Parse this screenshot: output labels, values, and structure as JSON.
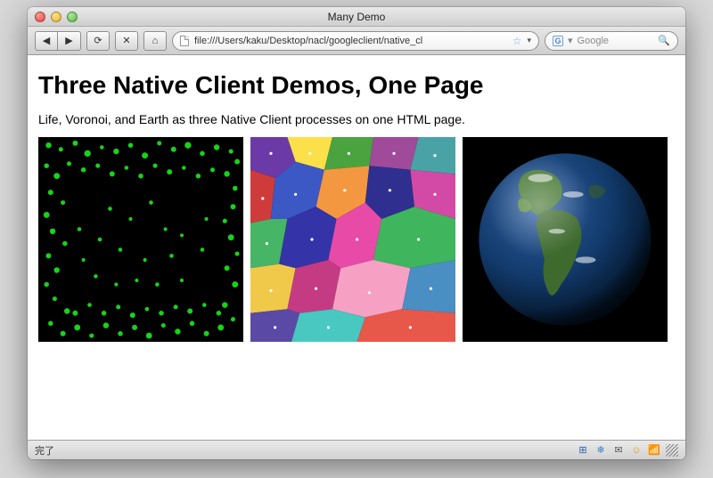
{
  "window": {
    "title": "Many Demo"
  },
  "toolbar": {
    "back": "◀",
    "fwd": "▶",
    "reload": "⟳",
    "stop": "✕",
    "home": "⌂"
  },
  "address": {
    "url": "file:///Users/kaku/Desktop/nacl/googleclient/native_cl",
    "star": "☆",
    "dropdown": "▾"
  },
  "search": {
    "engine_glyph": "G",
    "dropdown": "▾",
    "placeholder": "Google",
    "mag": "🔍"
  },
  "page": {
    "heading": "Three Native Client Demos, One Page",
    "subheading": "Life, Voronoi, and Earth as three Native Client processes on one HTML page."
  },
  "demos": {
    "life_label": "Life",
    "voronoi_label": "Voronoi",
    "earth_label": "Earth"
  },
  "statusbar": {
    "text": "完了",
    "icons": {
      "delicious": "⊞",
      "snow": "❄",
      "mail": "✉",
      "smiley": "☺",
      "feed": "📶"
    }
  }
}
